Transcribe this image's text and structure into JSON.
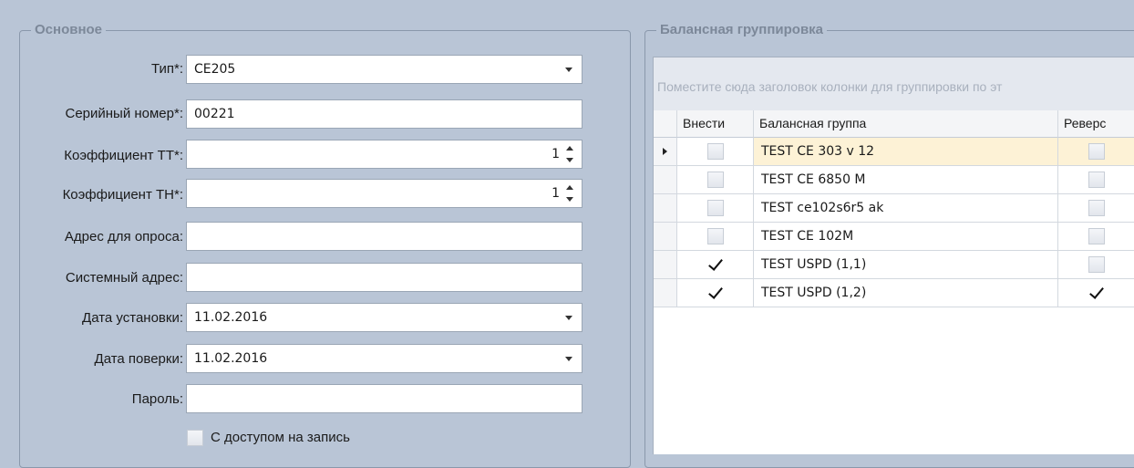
{
  "left_panel": {
    "title": "Основное",
    "fields": [
      {
        "label": "Тип*:",
        "value": "CE205",
        "kind": "dropdown"
      },
      {
        "label": "Серийный номер*:",
        "value": "00221",
        "kind": "text"
      },
      {
        "label": "Коэффициент ТТ*:",
        "value": "1",
        "kind": "spin"
      },
      {
        "label": "Коэффициент ТН*:",
        "value": "1",
        "kind": "spin"
      },
      {
        "label": "Адрес для опроса:",
        "value": "",
        "kind": "text"
      },
      {
        "label": "Системный адрес:",
        "value": "",
        "kind": "text"
      },
      {
        "label": "Дата установки:",
        "value": "11.02.2016",
        "kind": "dropdown"
      },
      {
        "label": "Дата поверки:",
        "value": "11.02.2016",
        "kind": "dropdown"
      },
      {
        "label": "Пароль:",
        "value": "",
        "kind": "text"
      }
    ],
    "write_access_label": "С доступом на запись",
    "write_access_checked": false
  },
  "right_panel": {
    "title": "Балансная группировка",
    "group_hint": "Поместите сюда заголовок колонки для группировки по эт",
    "columns": [
      "Внести",
      "Балансная группа",
      "Реверс"
    ],
    "rows": [
      {
        "include": false,
        "group": "TEST CE 303 v 12",
        "reverse": false,
        "focused": true
      },
      {
        "include": false,
        "group": "TEST CE 6850 M",
        "reverse": false,
        "focused": false
      },
      {
        "include": false,
        "group": "TEST ce102s6r5 ak",
        "reverse": false,
        "focused": false
      },
      {
        "include": false,
        "group": "TEST CE 102M",
        "reverse": false,
        "focused": false
      },
      {
        "include": true,
        "group": "TEST USPD (1,1)",
        "reverse": false,
        "focused": false
      },
      {
        "include": true,
        "group": "TEST USPD (1,2)",
        "reverse": true,
        "focused": false
      }
    ]
  }
}
